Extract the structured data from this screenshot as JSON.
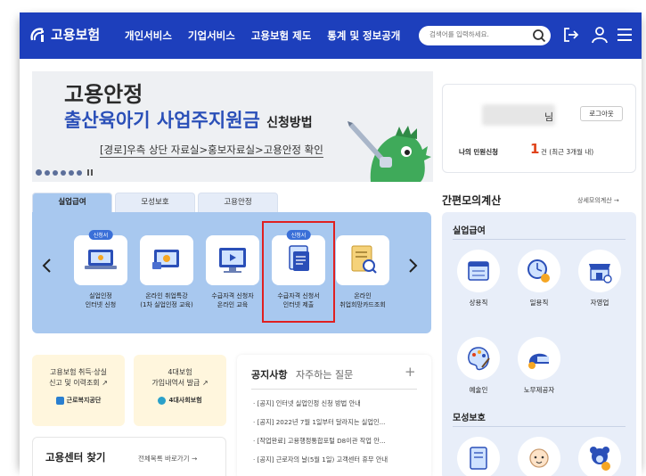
{
  "header": {
    "logo_text": "고용보험",
    "nav": [
      "개인서비스",
      "기업서비스",
      "고용보험 제도",
      "통계 및 정보공개"
    ],
    "search_placeholder": "검색어를 입력하세요."
  },
  "banner": {
    "title": "고용안정",
    "headline": "출산육아기 사업주지원금",
    "headline_suffix": "신청방법",
    "path": "[경로]우측 상단 자료실>홍보자료실>고용안정 확인"
  },
  "login": {
    "honorific": "님",
    "logout_label": "로그아웃",
    "civil_label": "나의 민원신청",
    "civil_count": "1",
    "civil_note": "건 (최근 3개월 내)"
  },
  "service_tabs": [
    "실업급여",
    "모성보호",
    "고용안정"
  ],
  "services": [
    {
      "label": "실업인정\n인터넷 신청",
      "badge": "신청서"
    },
    {
      "label": "온라인 취업특강\n(1차 실업인정 교육)",
      "badge": ""
    },
    {
      "label": "수급자격 신청자\n온라인 교육",
      "badge": ""
    },
    {
      "label": "수급자격 신청서\n인터넷 제출",
      "badge": "신청서"
    },
    {
      "label": "온라인\n취업희망카드조회",
      "badge": ""
    }
  ],
  "cards": [
    {
      "title": "고용보험 취득·상실\n신고 및 이력조회 ↗",
      "org": "근로복지공단"
    },
    {
      "title": "4대보험\n가입내역서 발급 ↗",
      "org": "4대사회보험"
    }
  ],
  "center": {
    "title": "고용센터 찾기",
    "link": "전체목록 바로가기 →"
  },
  "notice": {
    "tab_on": "공지사항",
    "tab_off": "자주하는 질문",
    "plus": "+",
    "items": [
      "· [공지] 인터넷 실업인정 신청 방법 안내",
      "· [공지] 2022년 7월 1일부터 달라지는 실업인...",
      "· [작업완료] 고용행정통합포털 D8이관 작업 안...",
      "· [공지] 근로자의 날(5월 1일) 고객센터 휴무 안내"
    ]
  },
  "calc": {
    "title": "간편모의계산",
    "more": "상세모의계산 →",
    "section1": "실업급여",
    "items1": [
      "상용직",
      "일용직",
      "자영업",
      "예술인",
      "노무제공자"
    ],
    "section2": "모성보호"
  },
  "colors": {
    "header_bg": "#1d3fbc",
    "panel_bg": "#a8c8ef",
    "highlight": "#e02020",
    "accent_orange": "#e0431a"
  }
}
